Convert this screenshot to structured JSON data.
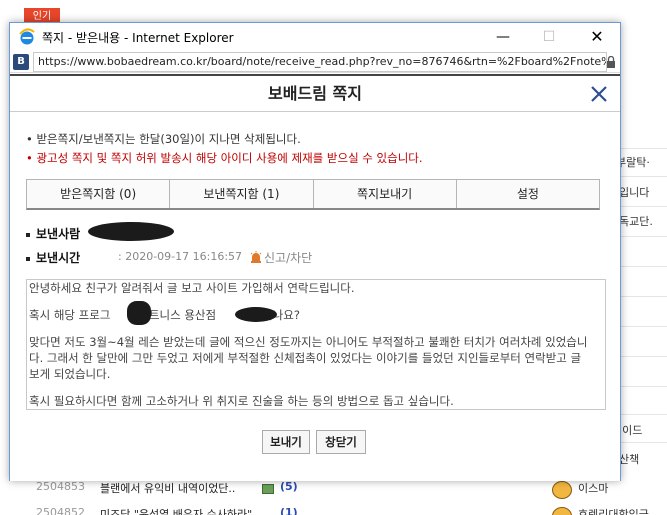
{
  "background": {
    "badge": "인기",
    "right_column": [
      "부랄탁·",
      "l입니다",
      "l독교단.",
      "ll이드",
      "l산책",
      "이스마"
    ],
    "rows": [
      {
        "num": "2504853",
        "title": "블랜에서 유익비 내역이었단..",
        "count": "(5)",
        "user": "이스마"
      },
      {
        "num": "2504852",
        "title": "미즈당 \"윤석열 배우자 수사하라\"",
        "count": "(1)",
        "user": "호렌리대학입금"
      }
    ]
  },
  "window": {
    "title": "쪽지 - 받은내용 - Internet Explorer",
    "url": "https://www.bobaedream.co.kr/board/note/receive_read.php?rev_no=876746&rtn=%2Fboard%2Fnote%",
    "site_icon": "B",
    "buttons": {
      "minimize": "—",
      "maximize": "☐",
      "close": "✕"
    }
  },
  "popup": {
    "title": "보배드림 쪽지",
    "notices": [
      "• 받은쪽지/보낸쪽지는 한달(30일)이 지나면 삭제됩니다.",
      "• 광고성 쪽지 및 쪽지 허위 발송시 해당 아이디 사용에 제재를 받으실 수 있습니다."
    ],
    "tabs": [
      "받은쪽지함 (0)",
      "보낸쪽지함 (1)",
      "쪽지보내기",
      "설정"
    ],
    "sender_label": "보낸사람",
    "time_label": "보낸시간",
    "time_value": ": 2020-09-17 16:16:57",
    "report_label": "신고/차단",
    "message": {
      "line1": "안녕하세요 친구가 알려줘서 글 보고 사이트 가입해서 연락드립니다.",
      "line2a": "혹시 해당 프로그",
      "line2b": "휘트니스 용산점",
      "line2c": "맞나요?",
      "para3": "맞다면 저도 3월~4월 레슨 받았는데 글에 적으신 정도까지는 아니어도 부적절하고 불쾌한 터치가 여러차례 있었습니다. 그래서 한 달만에 그만 두었고 저에게 부적절한 신체접촉이 있었다는 이야기를 들었던 지인들로부터 연락받고 글 보게 되었습니다.",
      "para4": "혹시 필요하시다면 함께 고소하거나 위 취지로 진술을 하는 등의 방법으로 돕고 싶습니다."
    },
    "buttons": {
      "send": "보내기",
      "close": "창닫기"
    }
  }
}
